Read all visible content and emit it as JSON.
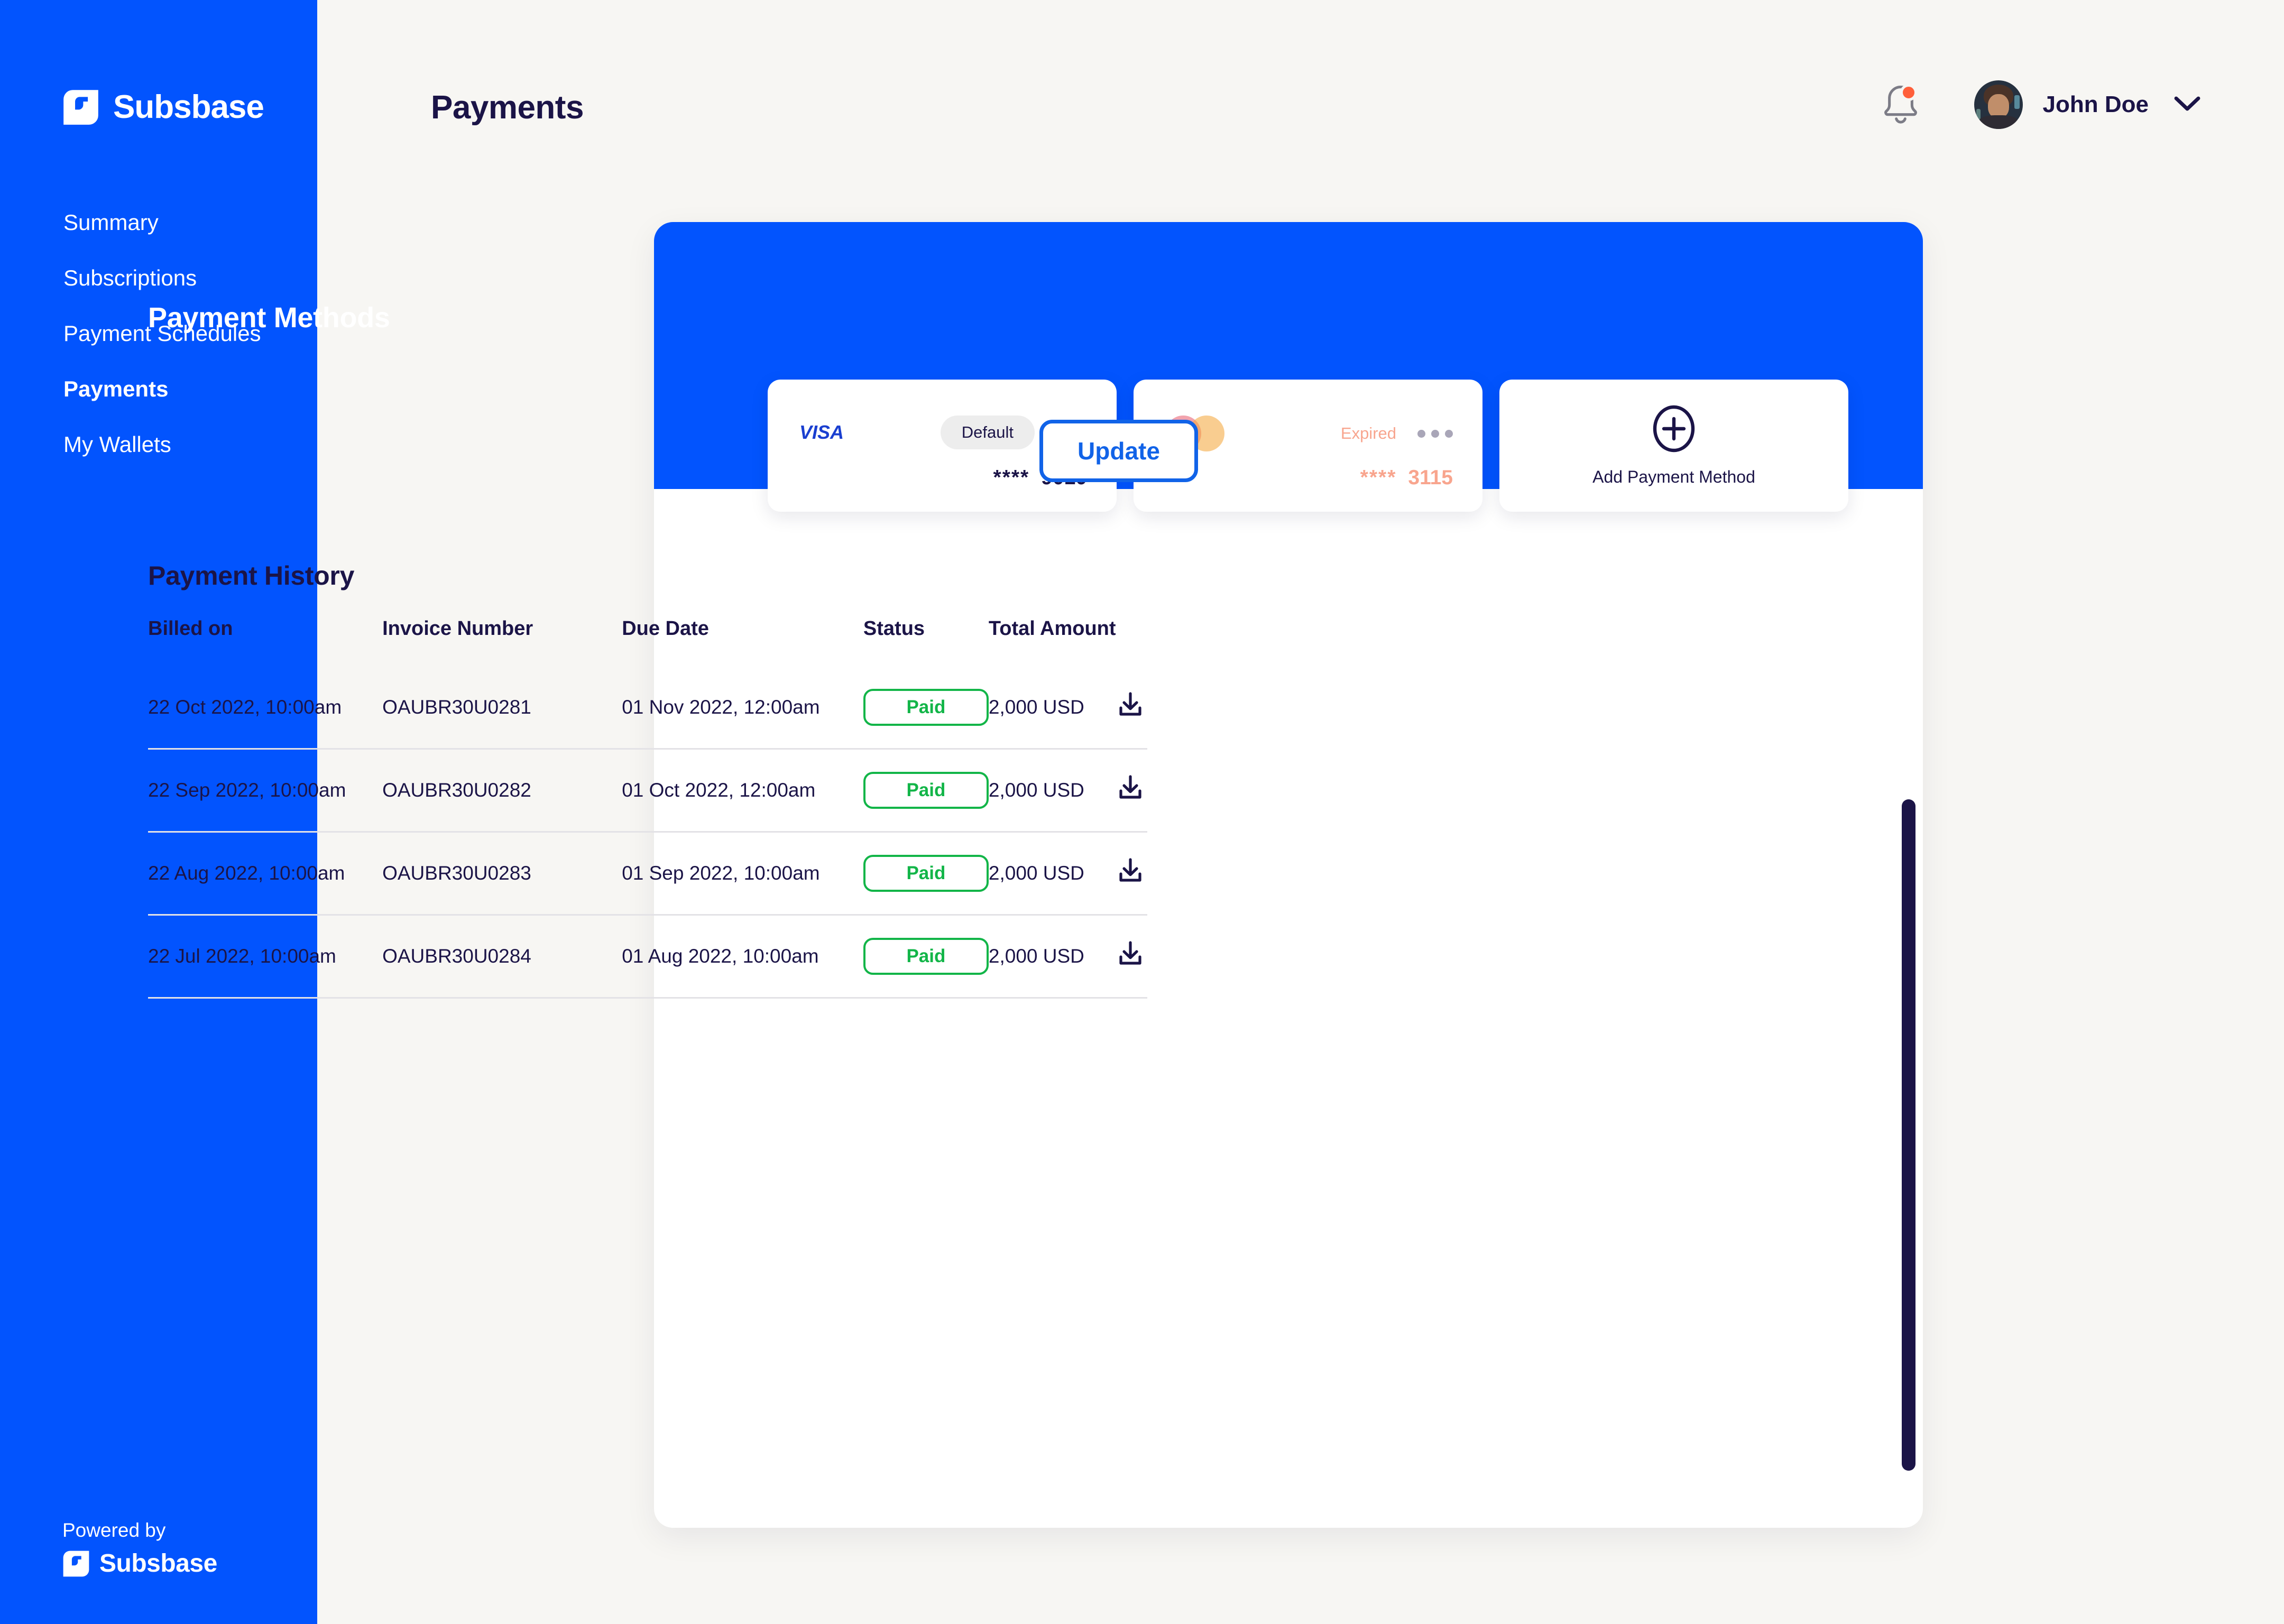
{
  "brand": {
    "name": "Subsbase",
    "logo_icon": "subsbase-logo-icon"
  },
  "sidebar": {
    "items": [
      {
        "label": "Summary",
        "active": false
      },
      {
        "label": "Subscriptions",
        "active": false
      },
      {
        "label": "Payment Schedules",
        "active": false
      },
      {
        "label": "Payments",
        "active": true
      },
      {
        "label": "My Wallets",
        "active": false
      }
    ],
    "footer": {
      "powered_by_label": "Powered by",
      "powered_by_brand": "Subsbase"
    }
  },
  "header": {
    "page_title": "Payments",
    "notification_icon": "bell-icon",
    "has_notification": true,
    "user_name": "John Doe",
    "chevron_icon": "chevron-down-icon",
    "avatar_icon": "avatar"
  },
  "payment_methods": {
    "section_title": "Payment Methods",
    "cards": [
      {
        "brand": "VISA",
        "brand_icon": "visa-logo-icon",
        "badge": "Default",
        "badge_type": "default",
        "mask": "****",
        "last4": "9010",
        "menu_icon": "more-options-icon",
        "expired": false
      },
      {
        "brand": "Mastercard",
        "brand_icon": "mastercard-logo-icon",
        "badge": "Expired",
        "badge_type": "expired",
        "mask": "****",
        "last4": "3115",
        "menu_icon": "more-options-icon",
        "expired": true,
        "action_label": "Update"
      },
      {
        "add_label": "Add Payment Method",
        "add_icon": "plus-circle-icon"
      }
    ]
  },
  "payment_history": {
    "section_title": "Payment History",
    "columns": [
      "Billed on",
      "Invoice Number",
      "Due Date",
      "Status",
      "Total Amount"
    ],
    "download_icon": "download-icon",
    "rows": [
      {
        "billed_on": "22 Oct 2022, 10:00am",
        "invoice_number": "OAUBR30U0281",
        "due_date": "01 Nov 2022, 12:00am",
        "status": "Paid",
        "total_amount": "2,000 USD"
      },
      {
        "billed_on": "22 Sep 2022, 10:00am",
        "invoice_number": "OAUBR30U0282",
        "due_date": "01 Oct 2022, 12:00am",
        "status": "Paid",
        "total_amount": "2,000 USD"
      },
      {
        "billed_on": "22 Aug 2022, 10:00am",
        "invoice_number": "OAUBR30U0283",
        "due_date": "01 Sep 2022, 10:00am",
        "status": "Paid",
        "total_amount": "2,000 USD"
      },
      {
        "billed_on": "22 Jul 2022, 10:00am",
        "invoice_number": "OAUBR30U0284",
        "due_date": "01 Aug 2022, 10:00am",
        "status": "Paid",
        "total_amount": "2,000 USD"
      }
    ]
  },
  "colors": {
    "brand_blue": "#0254fe",
    "accent_blue": "#1163e8",
    "navy": "#1b1447",
    "page_bg": "#f7f6f3",
    "paid_green": "#12b548",
    "expired_salmon": "#f8a58e",
    "notification_orange": "#ff5f3a",
    "badge_gray": "#ededed"
  }
}
